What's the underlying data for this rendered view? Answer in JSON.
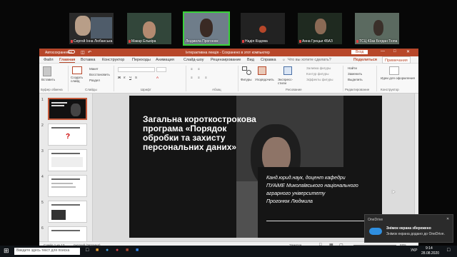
{
  "participants": [
    {
      "name": "Сергей ",
      "name2": "Інна Любанська"
    },
    {
      "name": "Макар Ельвіра"
    },
    {
      "name": "Людмила Прогонюк"
    },
    {
      "name": "Надія Кіздова"
    },
    {
      "name": "Анна Грецьи 4БАЗ"
    },
    {
      "name": "ТСЦ 43аз Богдан Тюпа"
    }
  ],
  "window": {
    "autosave": "Автосохранение",
    "title": "Інтерактивна лекція - Сохранено в этот компьютер",
    "signin": "Вход"
  },
  "menu": {
    "tabs": [
      "Файл",
      "Главная",
      "Вставка",
      "Конструктор",
      "Переходы",
      "Анимация",
      "Слайд-шоу",
      "Рецензирование",
      "Вид",
      "Справка"
    ],
    "search": "Что вы хотите сделать?",
    "share": "Поделиться",
    "notes": "Примечания"
  },
  "ribbon": {
    "paste": "Вставить",
    "create_slide": "Создать слайд",
    "layout": "Макет",
    "reset": "Восстановить",
    "section": "Раздел",
    "shapes": "Фигуры",
    "arrange": "Упорядочить",
    "quick_styles": "Экспресс-стили",
    "fill": "Заливка фигуры",
    "outline": "Контур фигуры",
    "effects": "Эффекты фигуры",
    "find": "Найти",
    "replace": "Заменить",
    "select": "Выделить",
    "ideas": "Идеи для оформления",
    "groups": [
      "Буфер обмена",
      "Слайды",
      "Шрифт",
      "Абзац",
      "Рисование",
      "Редактирование",
      "Конструктор"
    ]
  },
  "slide": {
    "title": "Загальна короткострокова\nпрограма «Порядок\nобробки та захисту\nперсональних даних»",
    "author": "Канд.юрид.наук, доцент кафедри\nПУАіМЕ Миколаївського національного\nаграрного університету\nПрогонюк Людмила"
  },
  "thumbs": {
    "numbers": [
      "1",
      "2",
      "3",
      "4",
      "5",
      "6"
    ]
  },
  "status": {
    "slide": "Слайд 1 из 13",
    "lang": "русский (Украина)",
    "notes_btn": "Заметки",
    "zoom": "68%"
  },
  "toast": {
    "app": "OneDrive",
    "title": "Знімок екрана збережено",
    "body": "Знімок екрана додано до OneDrive."
  },
  "taskbar": {
    "search": "Введите здесь текст для поиска",
    "lang": "УКР",
    "time": "9:14",
    "date": "28.08.2020"
  }
}
